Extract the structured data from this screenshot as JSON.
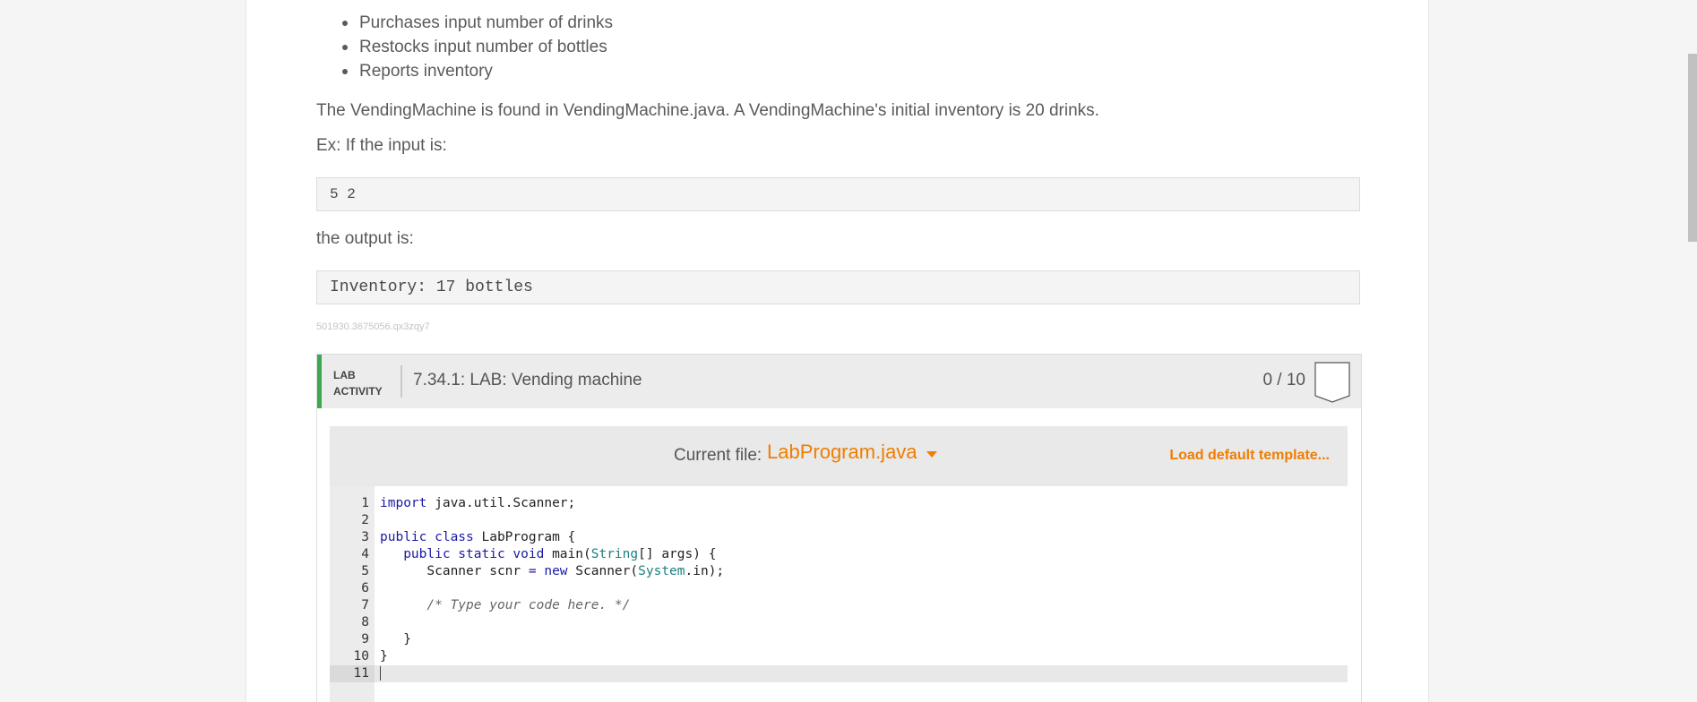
{
  "bullets": [
    "Purchases input number of drinks",
    "Restocks input number of bottles",
    "Reports inventory"
  ],
  "description": "The VendingMachine is found in VendingMachine.java. A VendingMachine's initial inventory is 20 drinks.",
  "example_label": "Ex: If the input is:",
  "example_input": "5 2",
  "output_label": "the output is:",
  "example_output": "Inventory: 17 bottles",
  "identifier": "501930.3675056.qx3zqy7",
  "lab": {
    "tag_line1": "LAB",
    "tag_line2": "ACTIVITY",
    "title": "7.34.1: LAB: Vending machine",
    "score": "0 / 10"
  },
  "editor": {
    "current_file_label": "Current file:",
    "current_file": "LabProgram.java",
    "load_template": "Load default template...",
    "line_numbers": [
      "1",
      "2",
      "3",
      "4",
      "5",
      "6",
      "7",
      "8",
      "9",
      "10",
      "11"
    ],
    "code": {
      "l1_kw": "import",
      "l1_rest": " java.util.Scanner;",
      "l3_kw": "public class",
      "l3_rest": " LabProgram {",
      "l4_indent": "   ",
      "l4_kw": "public static void",
      "l4_mid": " main(",
      "l4_type": "String",
      "l4_rest": "[] args) {",
      "l5_indent": "      Scanner scnr ",
      "l5_eq": "=",
      "l5_sp": " ",
      "l5_kw": "new",
      "l5_mid": " Scanner(",
      "l5_type": "System",
      "l5_rest": ".in);",
      "l7_indent": "      ",
      "l7_comment": "/* Type your code here. */",
      "l9": "   }",
      "l10": "}"
    }
  },
  "colors": {
    "accent": "#f07d00",
    "lab_bar": "#3ea84f",
    "keyword": "#1a1aa6",
    "type": "#1d7f7f"
  }
}
